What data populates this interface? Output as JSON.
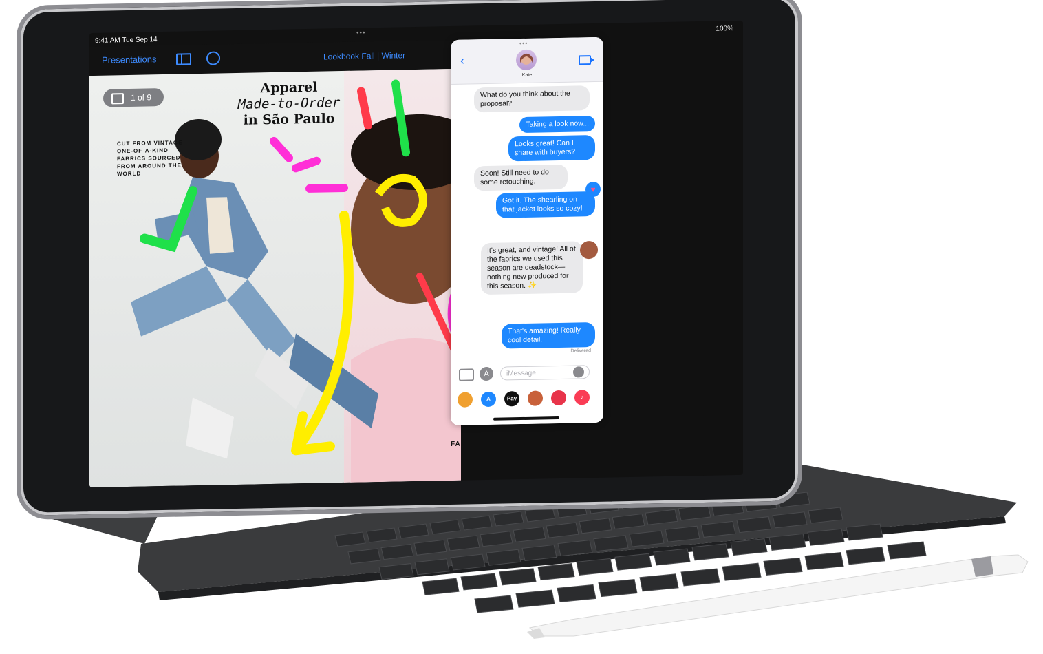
{
  "status_bar": {
    "time": "9:41 AM  Tue Sep 14",
    "battery": "100%",
    "multitask_dots": "•••"
  },
  "keynote": {
    "presentations_link": "Presentations",
    "document_title": "Lookbook Fall | Winter",
    "slide_counter": "1 of 9",
    "headline_lines": [
      "Apparel",
      "Made-to-Order",
      "in São Paulo"
    ],
    "sidebar_copy": "CUT FROM VINTAGE ONE-OF-A-KIND FABRICS SOURCED FROM AROUND THE WORLD",
    "footer_label": "FALL/WINTER"
  },
  "messages": {
    "top_dots": "•••",
    "contact_name": "Kate",
    "thread": [
      {
        "side": "in",
        "text": "What do you think about the proposal?"
      },
      {
        "side": "out",
        "text": "Taking a look now..."
      },
      {
        "side": "out",
        "text": "Looks great! Can I share with buyers?"
      },
      {
        "side": "in",
        "text": "Soon! Still need to do some retouching."
      },
      {
        "side": "out",
        "text": "Got it. The shearling on that jacket looks so cozy!"
      },
      {
        "side": "in",
        "text": "It's great, and vintage! All of the fabrics we used this season are deadstock—nothing new produced for this season. ✨"
      },
      {
        "side": "out",
        "text": "That's amazing! Really cool detail."
      }
    ],
    "delivered_label": "Delivered",
    "input_placeholder": "iMessage",
    "app_drawer": [
      {
        "icon": "photos-icon",
        "label": "",
        "color": "#f0a030"
      },
      {
        "icon": "app-store-icon",
        "label": "A",
        "color": "#1e88ff"
      },
      {
        "icon": "apple-pay-icon",
        "label": "Pay",
        "color": "#111111"
      },
      {
        "icon": "memoji-icon",
        "label": "",
        "color": "#c8613a"
      },
      {
        "icon": "search-images-icon",
        "label": "",
        "color": "#e8344a"
      },
      {
        "icon": "music-icon",
        "label": "♪",
        "color": "#fa3c55"
      }
    ]
  }
}
